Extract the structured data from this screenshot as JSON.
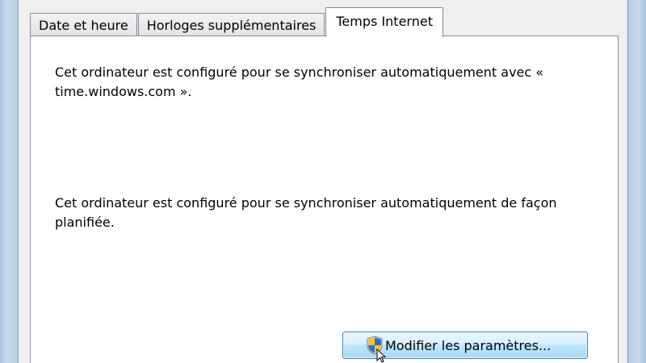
{
  "tabs": [
    {
      "label": "Date et heure"
    },
    {
      "label": "Horloges supplémentaires"
    },
    {
      "label": "Temps Internet",
      "active": true
    }
  ],
  "panel": {
    "paragraph1": "Cet ordinateur est configuré pour se synchroniser automatiquement avec « time.windows.com ».",
    "paragraph2": "Cet ordinateur est configuré pour se synchroniser automatiquement de façon planifiée.",
    "change_button_label": "Modifier les paramètres..."
  },
  "icons": {
    "button_icon": "uac-shield-icon",
    "pointer": "mouse-cursor-icon"
  },
  "colors": {
    "button_border": "#3c7fb1",
    "tab_border": "#898c95",
    "shield_blue": "#2f6fc4",
    "shield_yellow": "#f4c430"
  }
}
